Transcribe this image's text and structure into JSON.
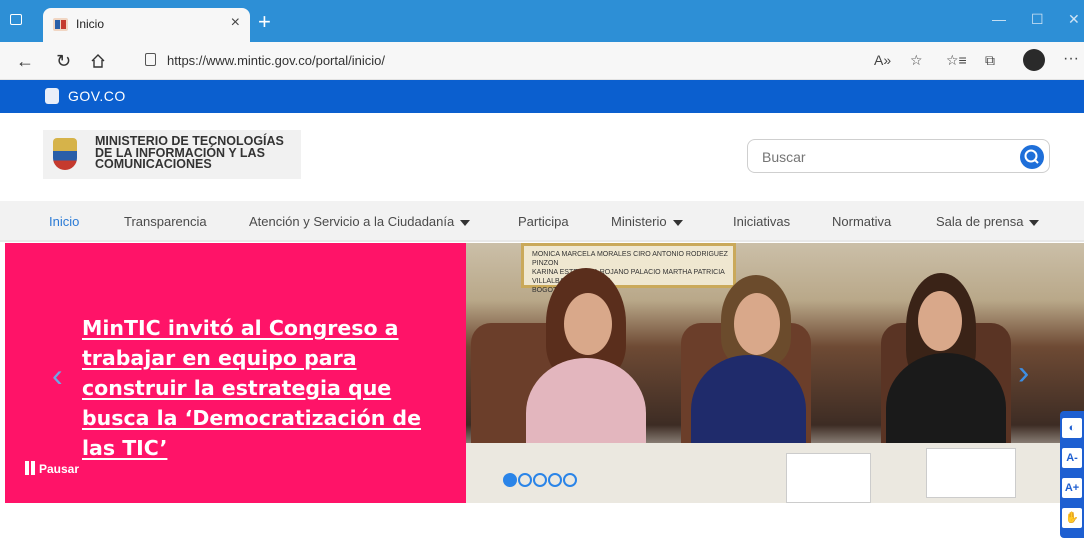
{
  "browser": {
    "tab_title": "Inicio",
    "url": "https://www.mintic.gov.co/portal/inicio/",
    "accent": "#2d8fd6"
  },
  "govbar": {
    "label": "GOV.CO",
    "color": "#0b5fcf"
  },
  "header": {
    "logo_text": "MINISTERIO DE TECNOLOGÍAS\nDE LA INFORMACIÓN Y LAS\nCOMUNICACIONES",
    "search_placeholder": "Buscar"
  },
  "menu": {
    "items": [
      {
        "label": "Inicio",
        "active": true
      },
      {
        "label": "Transparencia"
      },
      {
        "label": "Atención y Servicio a la Ciudadanía",
        "dropdown": true
      },
      {
        "label": "Participa"
      },
      {
        "label": "Ministerio",
        "dropdown": true
      },
      {
        "label": "Iniciativas"
      },
      {
        "label": "Normativa"
      },
      {
        "label": "Sala de prensa",
        "dropdown": true
      }
    ]
  },
  "banner": {
    "headline": "MinTIC invitó al Congreso a trabajar en equipo para construir la estrategia que busca la ‘Democratización de las TIC’",
    "pause_label": "Pausar",
    "color": "#ff1368",
    "slides_total": 5,
    "slide_active": 1,
    "plaque_text": "MONICA MARCELA MORALES     CIRO ANTONIO RODRIGUEZ PINZON\nKARINA ESTEFANIA ROJANO PALACIO  MARTHA PATRICIA VILLALBA HODWALKER\nBOGOTÁ, JUNIO DE 2022."
  },
  "accessibility": {
    "buttons": [
      "contrast-icon",
      "decrease-font-icon",
      "increase-font-icon",
      "sign-language-icon"
    ],
    "labels": [
      "A-",
      "A+"
    ]
  }
}
